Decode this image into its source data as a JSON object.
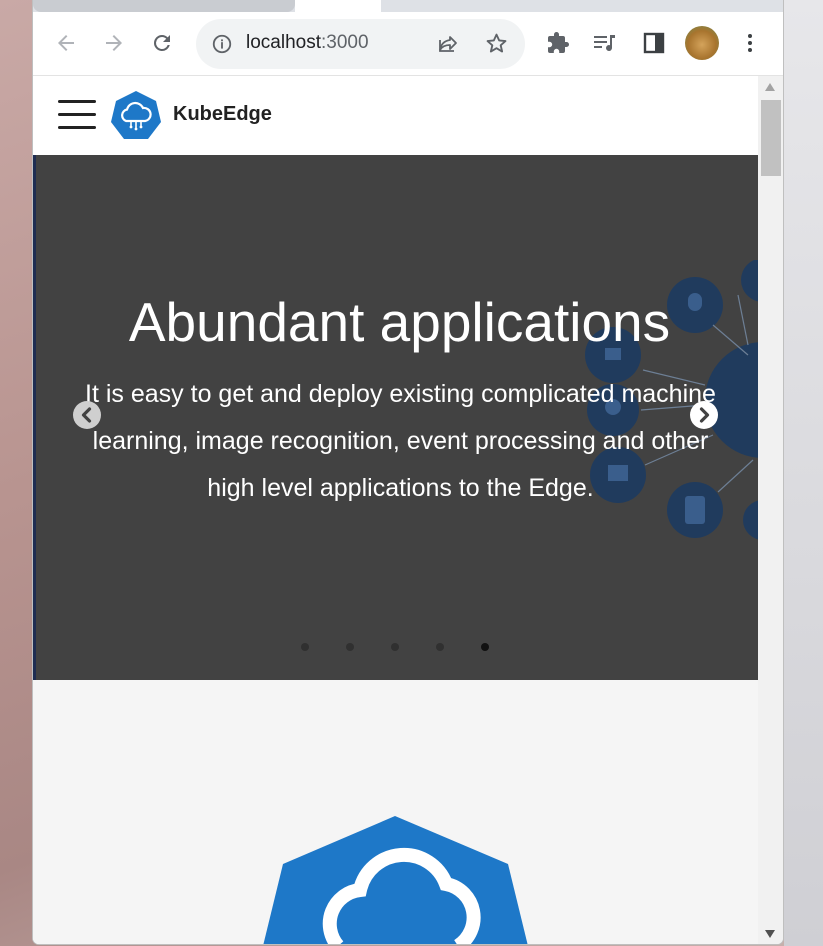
{
  "browser": {
    "address_bar": {
      "host": "localhost",
      "port": ":3000"
    },
    "icons": {
      "back": "arrow-left-icon",
      "forward": "arrow-right-icon",
      "reload": "reload-icon",
      "site_info": "info-icon",
      "share": "share-icon",
      "bookmark": "star-icon",
      "extensions": "puzzle-icon",
      "media": "media-queue-icon",
      "side_panel": "side-panel-icon",
      "profile": "avatar",
      "menu": "kebab-menu-icon"
    }
  },
  "site": {
    "name": "KubeEdge",
    "brand_color": "#1e78c8"
  },
  "hero": {
    "title": "Abundant applications",
    "text": "It is easy to get and deploy existing complicated machine learning, image recognition, event processing and other high level applications to the Edge.",
    "slide_count": 5,
    "active_slide": 5
  }
}
